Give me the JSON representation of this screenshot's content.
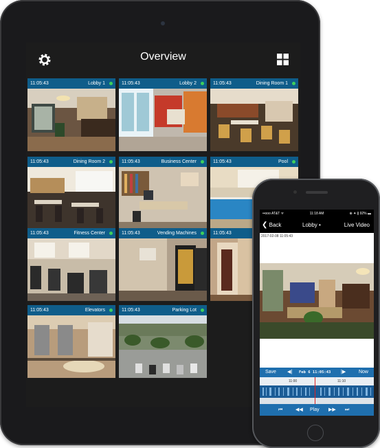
{
  "tablet": {
    "title": "Overview",
    "cameras": [
      {
        "time": "11:05:43",
        "name": "Lobby 1",
        "status": "online"
      },
      {
        "time": "11:05:43",
        "name": "Lobby 2",
        "status": "online"
      },
      {
        "time": "11:05:43",
        "name": "Dining Room 1",
        "status": "online"
      },
      {
        "time": "11:05:43",
        "name": "Dining Room 2",
        "status": "online"
      },
      {
        "time": "11:05:43",
        "name": "Business Center",
        "status": "online"
      },
      {
        "time": "11:05:43",
        "name": "Pool",
        "status": "online"
      },
      {
        "time": "11:05:43",
        "name": "Fitness Center",
        "status": "online"
      },
      {
        "time": "11:05:43",
        "name": "Vending Machines",
        "status": "online"
      },
      {
        "time": "11:05:43",
        "name": "",
        "status": "online"
      },
      {
        "time": "11:05:43",
        "name": "Elevators",
        "status": "online"
      },
      {
        "time": "11:05:43",
        "name": "Parking Lot",
        "status": "online"
      }
    ],
    "icons": {
      "settings": "gear-icon",
      "layout": "grid-icon"
    }
  },
  "phone": {
    "status_bar": {
      "carrier": "••ooo AT&T ᯤ",
      "time": "11:18 AM",
      "battery": "⊕ ✦ ∦ 92% ▬"
    },
    "nav": {
      "back_label": "Back",
      "title": "Lobby",
      "title_suffix": "•",
      "right_label": "Live Video"
    },
    "timestamp": "2017-02-08 11:05:43",
    "controls": {
      "save_label": "Save",
      "prev_label": "◀|",
      "date_label": "Feb 6 11:05:43",
      "next_label": "|▶",
      "now_label": "Now"
    },
    "timeline": {
      "tick_1": "11:00",
      "tick_2": "11:10"
    },
    "playback": {
      "skip_back": "⏮",
      "rewind": "◀◀",
      "play_label": "Play",
      "forward": "▶▶",
      "skip_forward": "⏭"
    }
  },
  "colors": {
    "accent": "#0f5d8a",
    "online": "#3ecf5c",
    "control_blue": "#1f6fae"
  }
}
